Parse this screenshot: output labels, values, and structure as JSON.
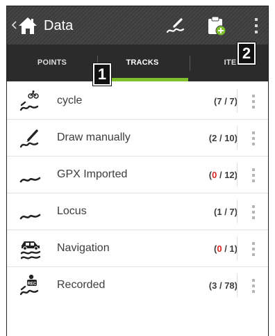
{
  "actionbar": {
    "title": "Data",
    "back_icon": "chevron-left-icon",
    "home_icon": "home-icon",
    "actions": [
      {
        "icon": "draw-track-icon"
      },
      {
        "icon": "import-clipboard-icon"
      },
      {
        "icon": "overflow-menu-icon"
      }
    ],
    "background_color": "#3f3f3f"
  },
  "tabs": [
    {
      "label": "POINTS",
      "selected": false
    },
    {
      "label": "TRACKS",
      "selected": true
    },
    {
      "label": "ITE",
      "selected": false
    }
  ],
  "accent_color": "#7dc02b",
  "callouts": [
    {
      "label": "1"
    },
    {
      "label": "2"
    }
  ],
  "tracks": [
    {
      "name": "cycle",
      "count_visible": "7",
      "count_total": "7",
      "visible_highlight": false,
      "icon": "cycle-track-icon"
    },
    {
      "name": "Draw manually",
      "count_visible": "2",
      "count_total": "10",
      "visible_highlight": false,
      "icon": "draw-track-icon"
    },
    {
      "name": "GPX Imported",
      "count_visible": "0",
      "count_total": "12",
      "visible_highlight": true,
      "icon": "track-line-icon"
    },
    {
      "name": "Locus",
      "count_visible": "1",
      "count_total": "7",
      "visible_highlight": false,
      "icon": "track-line-icon"
    },
    {
      "name": "Navigation",
      "count_visible": "0",
      "count_total": "1",
      "visible_highlight": true,
      "icon": "car-track-icon"
    },
    {
      "name": "Recorded",
      "count_visible": "3",
      "count_total": "78",
      "visible_highlight": false,
      "icon": "rec-track-icon"
    }
  ],
  "zero_count_color": "#d9271f"
}
